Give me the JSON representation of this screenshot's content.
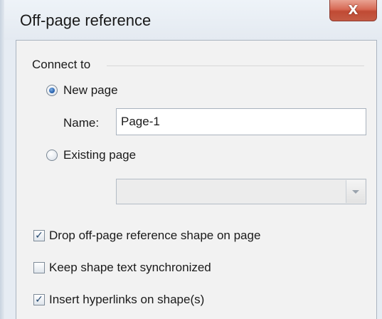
{
  "window": {
    "title": "Off-page reference",
    "close_glyph": "X"
  },
  "connect_group": {
    "label": "Connect to",
    "new_page_label": "New page",
    "new_page_selected": true,
    "name_label": "Name:",
    "name_value": "Page-1",
    "existing_page_label": "Existing page",
    "existing_page_selected": false,
    "existing_page_value": ""
  },
  "options": {
    "drop_shape_label": "Drop off-page reference shape on page",
    "drop_shape_checked": true,
    "keep_sync_label": "Keep shape text synchronized",
    "keep_sync_checked": false,
    "insert_hyperlinks_label": "Insert hyperlinks on shape(s)",
    "insert_hyperlinks_checked": true,
    "check_glyph": "✓"
  }
}
